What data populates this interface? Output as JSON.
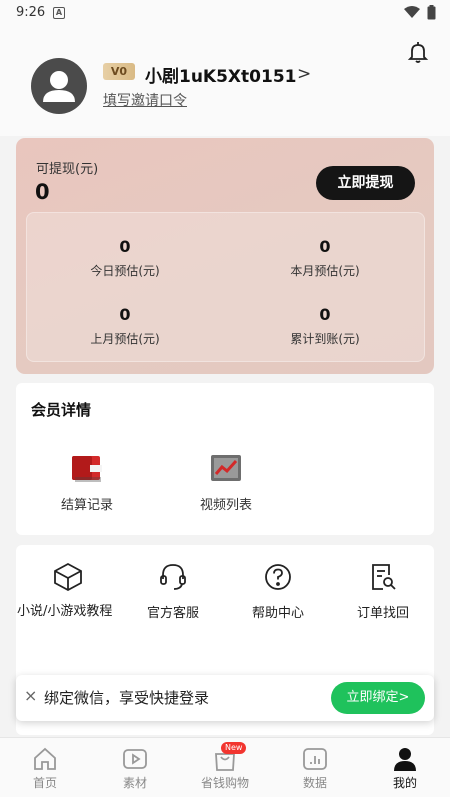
{
  "status_bar": {
    "time": "9:26",
    "notification_icon": "A"
  },
  "profile": {
    "vip_level": "V0",
    "username": "小剧1uK5Xt0151",
    "chevron": ">",
    "invite_link": "填写邀请口令"
  },
  "earnings": {
    "withdrawable_label": "可提现(元)",
    "withdrawable_value": "0",
    "withdraw_button": "立即提现",
    "stats": [
      {
        "value": "0",
        "label": "今日预估(元)"
      },
      {
        "value": "0",
        "label": "本月预估(元)"
      },
      {
        "value": "0",
        "label": "上月预估(元)"
      },
      {
        "value": "0",
        "label": "累计到账(元)"
      }
    ]
  },
  "member": {
    "title": "会员详情",
    "items": [
      {
        "label": "结算记录",
        "icon": "wallet-icon"
      },
      {
        "label": "视频列表",
        "icon": "chart-icon"
      }
    ]
  },
  "services": [
    {
      "label": "小说/小游戏教程",
      "icon": "cube-icon"
    },
    {
      "label": "官方客服",
      "icon": "headset-icon"
    },
    {
      "label": "帮助中心",
      "icon": "help-icon"
    },
    {
      "label": "订单找回",
      "icon": "order-search-icon"
    }
  ],
  "wechat_banner": {
    "close": "×",
    "text": "绑定微信，享受快捷登录",
    "button": "立即绑定>"
  },
  "tabbar": {
    "tabs": [
      {
        "label": "首页",
        "icon": "home-icon"
      },
      {
        "label": "素材",
        "icon": "play-icon"
      },
      {
        "label": "省钱购物",
        "icon": "shopping-bag-icon"
      },
      {
        "label": "数据",
        "icon": "data-icon"
      },
      {
        "label": "我的",
        "icon": "user-icon"
      }
    ],
    "new_badge": "New"
  },
  "colors": {
    "accent": "#1fc25c",
    "dark_button": "#151515",
    "earn_card": "#e9c6be",
    "badge": "#f2352f"
  }
}
